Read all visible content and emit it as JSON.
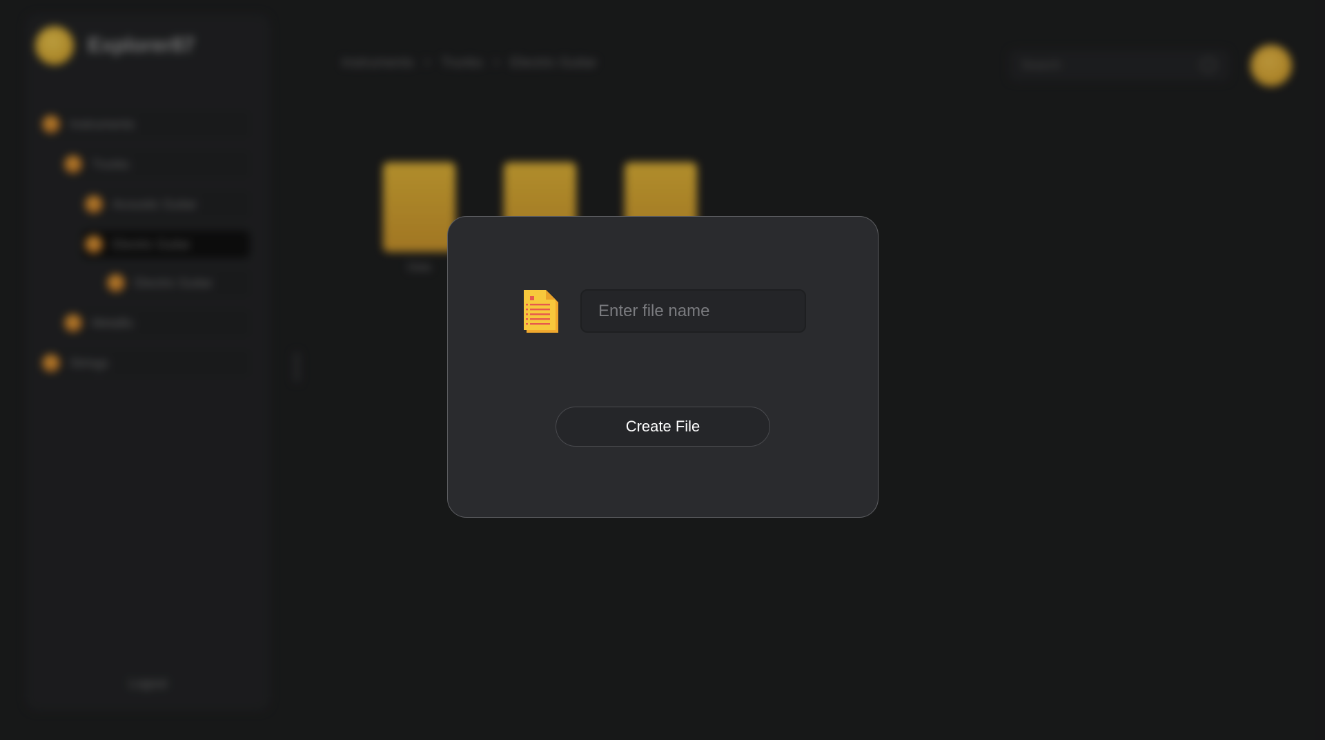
{
  "brand": {
    "name": "Explorer87"
  },
  "sidebar": {
    "items": [
      {
        "label": "Instruments"
      },
      {
        "label": "Trunks"
      },
      {
        "label": "Acoustic Guitar"
      },
      {
        "label": "Electric Guitar"
      },
      {
        "label": "Electric Guitar"
      },
      {
        "label": "Metallic"
      },
      {
        "label": "Strings"
      }
    ],
    "logout_label": "Logout"
  },
  "breadcrumb": {
    "items": [
      "Instruments",
      "Trunks",
      "Electric Guitar"
    ],
    "separator": ">"
  },
  "search": {
    "placeholder": "Search"
  },
  "files": [
    {
      "label": "Data"
    },
    {
      "label": ""
    },
    {
      "label": ""
    }
  ],
  "modal": {
    "input_placeholder": "Enter file name",
    "create_button_label": "Create File"
  },
  "colors": {
    "background": "#1b1c1d",
    "modal_bg": "#2a2b2e",
    "accent": "#f3c24a",
    "file_icon": "#f5c33b",
    "file_lines": "#e6594d"
  }
}
